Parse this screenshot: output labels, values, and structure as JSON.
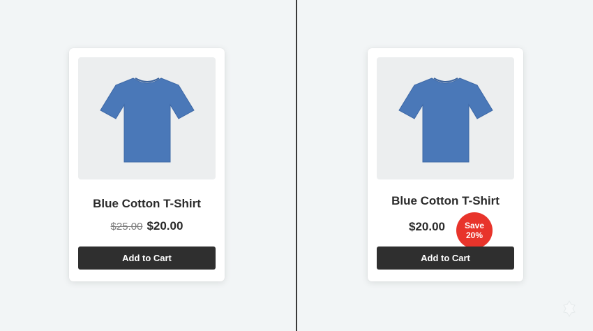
{
  "left_card": {
    "title": "Blue Cotton T-Shirt",
    "old_price": "$25.00",
    "price": "$20.00",
    "button_label": "Add to Cart"
  },
  "right_card": {
    "title": "Blue Cotton T-Shirt",
    "price": "$20.00",
    "badge_line1": "Save",
    "badge_line2": "20%",
    "button_label": "Add to Cart"
  },
  "colors": {
    "shirt": "#4a78b8",
    "badge": "#e8342b",
    "button": "#2f2f2f",
    "background": "#f2f5f6"
  },
  "icons": {
    "product_image": "tshirt-icon",
    "corner": "watermark-icon"
  }
}
